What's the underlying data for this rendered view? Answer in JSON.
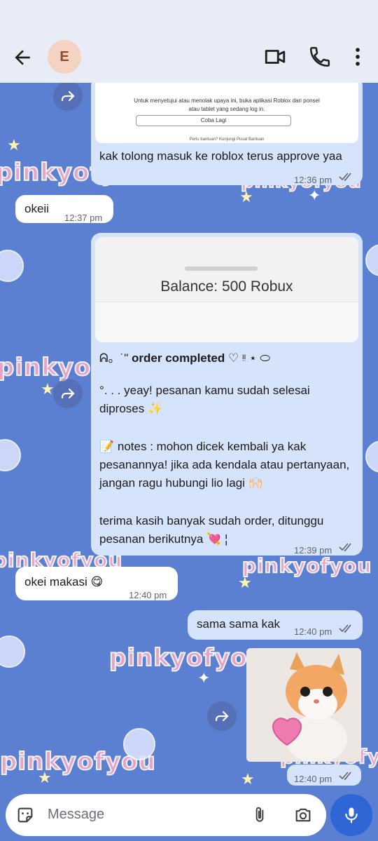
{
  "header": {
    "avatar_letter": "E",
    "icons": [
      "back-arrow-icon",
      "video-call-icon",
      "phone-icon",
      "more-vert-icon"
    ]
  },
  "wallpaper": {
    "watermark": "pinkyofyou"
  },
  "messages": [
    {
      "direction": "outgoing",
      "image": {
        "line1": "Untuk menyetujui atau menolak upaya ini, buka aplikasi Roblox dari ponsel",
        "line2": "atau tablet yang sedang log in.",
        "button": "Coba Lagi",
        "footer": "Perlu bantuan? Kunjungi Pusat Bantuan"
      },
      "text": "kak tolong masuk ke roblox terus approve yaa",
      "time": "12:36 pm",
      "status": "read"
    },
    {
      "direction": "incoming",
      "text": "okeii",
      "time": "12:37 pm"
    },
    {
      "direction": "outgoing",
      "image": {
        "caption": "Balance: 500 Robux"
      },
      "header_text": "order completed",
      "header_prefix": "ᕱ。˙\"",
      "header_suffix": "♡ ᵎᵎ ⋆ ⬭",
      "line_yeay": "°. . . yeay! pesanan kamu sudah selesai diproses ✨",
      "notes": "📝 notes : mohon dicek kembali ya kak pesanannya! jika ada kendala atau pertanyaan, jangan ragu hubungi lio lagi 🙌🏻",
      "thanks": "terima kasih banyak sudah order, ditunggu pesanan berikutnya 💘 ¦",
      "time": "12:39 pm",
      "status": "read"
    },
    {
      "direction": "incoming",
      "text": "okei makasi 😋",
      "time": "12:40 pm"
    },
    {
      "direction": "outgoing",
      "text": "sama sama kak",
      "time": "12:40 pm",
      "status": "read"
    },
    {
      "direction": "outgoing",
      "sticker": "kitten holding heart",
      "time": "12:40 pm",
      "status": "read"
    }
  ],
  "composer": {
    "placeholder": "Message",
    "icons": [
      "sticker-icon",
      "attach-icon",
      "camera-icon",
      "mic-icon"
    ]
  },
  "colors": {
    "wallpaper": "#5b7fd1",
    "outgoing": "#d6e4fb",
    "incoming": "#ffffff",
    "accent": "#2f66d6"
  }
}
